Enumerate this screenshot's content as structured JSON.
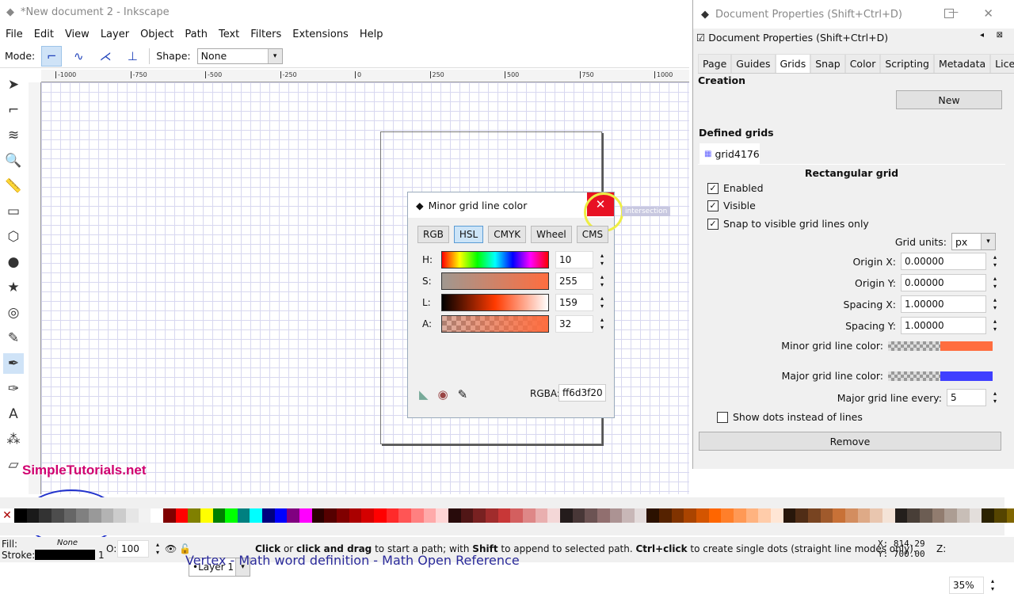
{
  "window": {
    "title": "*New document 2 - Inkscape"
  },
  "menu": [
    "File",
    "Edit",
    "View",
    "Layer",
    "Object",
    "Path",
    "Text",
    "Filters",
    "Extensions",
    "Help"
  ],
  "tool_controls": {
    "mode_label": "Mode:",
    "shape_label": "Shape:",
    "shape_value": "None"
  },
  "ruler_labels": [
    "-1000",
    "-750",
    "-500",
    "-250",
    "0",
    "250",
    "500",
    "750",
    "1000"
  ],
  "tools": [
    "selector-icon",
    "node-icon",
    "tweak-icon",
    "zoom-icon",
    "measure-icon",
    "rectangle-icon",
    "3dbox-icon",
    "ellipse-icon",
    "star-icon",
    "spiral-icon",
    "pencil-icon",
    "pen-icon",
    "calligraphy-icon",
    "text-icon",
    "spray-icon",
    "eraser-icon"
  ],
  "watermark": "SimpleTutorials.net",
  "palette": [
    "#000000",
    "#1a1a1a",
    "#333333",
    "#4d4d4d",
    "#666666",
    "#808080",
    "#999999",
    "#b3b3b3",
    "#cccccc",
    "#e6e6e6",
    "#f2f2f2",
    "#ffffff",
    "#800000",
    "#ff0000",
    "#808000",
    "#ffff00",
    "#008000",
    "#00ff00",
    "#008080",
    "#00ffff",
    "#000080",
    "#0000ff",
    "#800080",
    "#ff00ff",
    "#2b0000",
    "#550000",
    "#800000",
    "#aa0000",
    "#d40000",
    "#ff0000",
    "#ff2a2a",
    "#ff5555",
    "#ff8080",
    "#ffaaaa",
    "#ffd5d5",
    "#280b0b",
    "#501616",
    "#782121",
    "#a02c2c",
    "#c83737",
    "#d35f5f",
    "#de8787",
    "#e9afaf",
    "#f4d7d7",
    "#241c1c",
    "#483737",
    "#6c5353",
    "#916f6f",
    "#ac9393",
    "#c8b7b7",
    "#e3dbdb",
    "#2b1100",
    "#552200",
    "#803300",
    "#aa4400",
    "#d45500",
    "#ff6600",
    "#ff7f2a",
    "#ff9955",
    "#ffb380",
    "#ffccaa",
    "#ffe6d5",
    "#28170b",
    "#502d16",
    "#784421",
    "#a05a2c",
    "#c87137",
    "#d38d5f",
    "#deaa87",
    "#e9c6af",
    "#f4e3d7",
    "#241f1c",
    "#483e37",
    "#6c5d53",
    "#917c6f",
    "#ac9d93",
    "#c8beb7",
    "#e3dedb",
    "#2b2200",
    "#554400",
    "#806600"
  ],
  "status": {
    "fill_label": "Fill:",
    "fill_value": "None",
    "stroke_label": "Stroke:",
    "stroke_width": "1",
    "opacity_label": "O:",
    "opacity": "100",
    "layer": "•Layer 1",
    "message_parts": [
      {
        "b": "Click"
      },
      {
        "t": " or "
      },
      {
        "b": "click and drag"
      },
      {
        "t": " to start a path; with "
      },
      {
        "b": "Shift"
      },
      {
        "t": " to append to selected path. "
      },
      {
        "b": "Ctrl+click"
      },
      {
        "t": " to create single dots (straight line modes only)."
      }
    ],
    "x_label": "X:",
    "x": "814.29",
    "y_label": "Y:",
    "y": "700.00",
    "zoom_label": "Z:",
    "zoom": "35%"
  },
  "color_dialog": {
    "title": "Minor grid line color",
    "tabs": [
      "RGB",
      "HSL",
      "CMYK",
      "Wheel",
      "CMS"
    ],
    "active_tab": "HSL",
    "channels": [
      {
        "label": "H:",
        "value": "10"
      },
      {
        "label": "S:",
        "value": "255"
      },
      {
        "label": "L:",
        "value": "159"
      },
      {
        "label": "A:",
        "value": "32"
      }
    ],
    "rgba_label": "RGBA:",
    "rgba": "ff6d3f20",
    "tooltip": "intersection"
  },
  "doc_props": {
    "window_title": "Document Properties (Shift+Ctrl+D)",
    "panel_title": "Document Properties (Shift+Ctrl+D)",
    "tabs": [
      "Page",
      "Guides",
      "Grids",
      "Snap",
      "Color",
      "Scripting",
      "Metadata",
      "License"
    ],
    "active_tab": "Grids",
    "creation_label": "Creation",
    "grid_type": "Rectangular grid",
    "new_label": "New",
    "defined_label": "Defined grids",
    "grid_tab": "grid4176",
    "section_title": "Rectangular grid",
    "enabled": "Enabled",
    "visible": "Visible",
    "snap_visible": "Snap to visible grid lines only",
    "units_label": "Grid units:",
    "units": "px",
    "origin_x_label": "Origin X:",
    "origin_x": "0.00000",
    "origin_y_label": "Origin Y:",
    "origin_y": "0.00000",
    "spacing_x_label": "Spacing X:",
    "spacing_x": "1.00000",
    "spacing_y_label": "Spacing Y:",
    "spacing_y": "1.00000",
    "minor_label": "Minor grid line color:",
    "minor_color": "#ff6d3f",
    "major_label": "Major grid line color:",
    "major_color": "#3f3fff",
    "major_every_label": "Major grid line every:",
    "major_every": "5",
    "dots_label": "Show dots instead of lines",
    "remove_label": "Remove"
  },
  "background_text": "Vertex - Math word definition - Math Open Reference"
}
